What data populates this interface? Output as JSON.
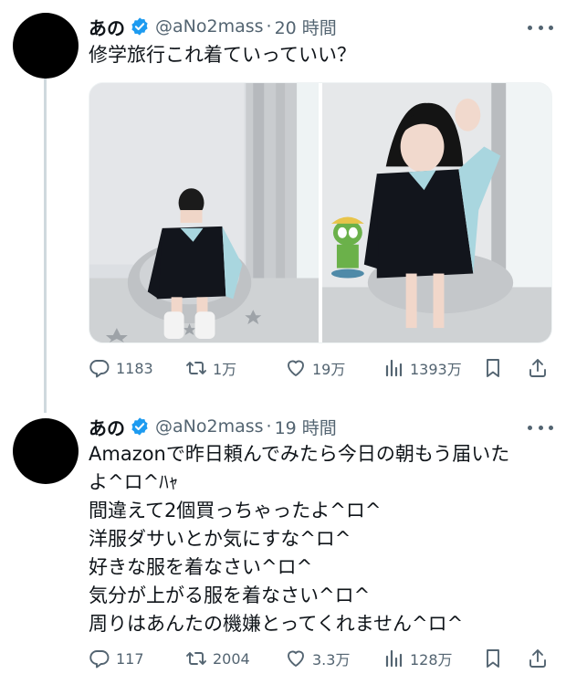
{
  "tweets": [
    {
      "display_name": "あの",
      "handle": "@aNo2mass",
      "separator": "·",
      "time": "20 時間",
      "text_lines": [
        "修学旅行これ着ていっていい？"
      ],
      "media_count": 2,
      "stats": {
        "replies": "1183",
        "reposts": "1万",
        "likes": "19万",
        "views": "1393万"
      }
    },
    {
      "display_name": "あの",
      "handle": "@aNo2mass",
      "separator": "·",
      "time": "19 時間",
      "text_lines": [
        "Amazonで昨日頼んでみたら今日の朝もう届いた",
        "よ^ロ^ﾊｬ",
        "間違えて2個買っちゃったよ^ロ^",
        "洋服ダサいとか気にすな^ロ^",
        "好きな服を着なさい^ロ^",
        "気分が上がる服を着なさい^ロ^",
        "周りはあんたの機嫌とってくれません^ロ^"
      ],
      "stats": {
        "replies": "117",
        "reposts": "2004",
        "likes": "3.3万",
        "views": "128万"
      }
    }
  ],
  "icons": {
    "verified": "verified-badge-icon",
    "more": "more-dots-icon",
    "reply": "reply-bubble-icon",
    "repost": "repost-arrows-icon",
    "like": "heart-icon",
    "views": "analytics-bars-icon",
    "bookmark": "bookmark-icon",
    "share": "share-arrow-icon"
  },
  "colors": {
    "verified_blue": "#1d9bf0",
    "secondary_text": "#536471",
    "thread_line": "#cfd9de"
  }
}
